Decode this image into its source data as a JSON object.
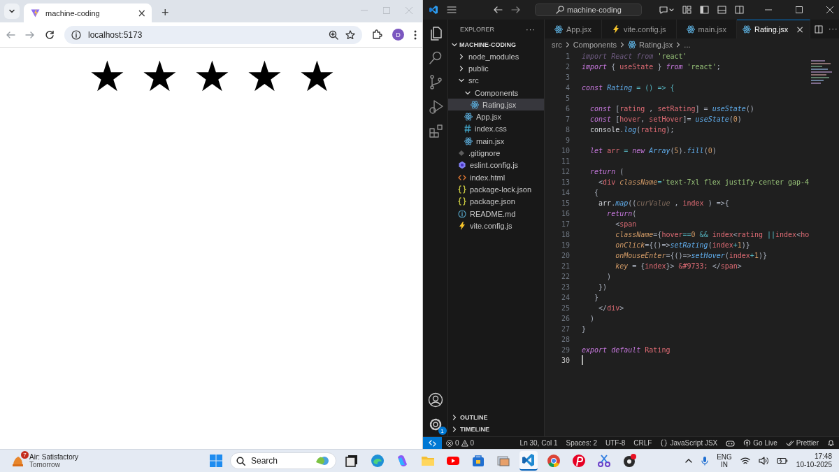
{
  "browser": {
    "tab": {
      "title": "machine-coding",
      "close": "×"
    },
    "new_tab": "+",
    "address": "localhost:5173",
    "profile_initial": "D",
    "page": {
      "rating_stars": [
        "★",
        "★",
        "★",
        "★",
        "★"
      ]
    }
  },
  "editor": {
    "command_center": "machine-coding",
    "activity_bar": [
      {
        "kind": "files",
        "selected": true
      },
      {
        "kind": "search",
        "selected": false
      },
      {
        "kind": "source-control",
        "selected": false
      },
      {
        "kind": "run-debug",
        "selected": false
      },
      {
        "kind": "extensions",
        "selected": false
      }
    ],
    "settings_badge": "1",
    "explorer": {
      "title": "EXPLORER",
      "more": "···",
      "root": "MACHINE-CODING",
      "tree": [
        {
          "label": "node_modules",
          "kind": "folder",
          "expanded": false,
          "selected": false
        },
        {
          "label": "public",
          "kind": "folder",
          "expanded": false,
          "selected": false
        },
        {
          "label": "src",
          "kind": "folder",
          "expanded": true,
          "selected": false,
          "children": [
            {
              "label": "Components",
              "kind": "folder",
              "expanded": true,
              "selected": false,
              "children": [
                {
                  "label": "Rating.jsx",
                  "kind": "react",
                  "selected": true
                }
              ]
            },
            {
              "label": "App.jsx",
              "kind": "react",
              "selected": false
            },
            {
              "label": "index.css",
              "kind": "css",
              "selected": false
            },
            {
              "label": "main.jsx",
              "kind": "react",
              "selected": false
            }
          ]
        },
        {
          "label": ".gitignore",
          "kind": "git",
          "selected": false
        },
        {
          "label": "eslint.config.js",
          "kind": "eslint",
          "selected": false
        },
        {
          "label": "index.html",
          "kind": "html",
          "selected": false
        },
        {
          "label": "package-lock.json",
          "kind": "json",
          "selected": false
        },
        {
          "label": "package.json",
          "kind": "json",
          "selected": false
        },
        {
          "label": "README.md",
          "kind": "info",
          "selected": false
        },
        {
          "label": "vite.config.js",
          "kind": "vite",
          "selected": false
        }
      ],
      "sections": [
        "OUTLINE",
        "TIMELINE"
      ]
    },
    "tabs": [
      {
        "label": "App.jsx",
        "kind": "react",
        "selected": false
      },
      {
        "label": "vite.config.js",
        "kind": "vite",
        "selected": false
      },
      {
        "label": "main.jsx",
        "kind": "react",
        "selected": false
      },
      {
        "label": "Rating.jsx",
        "kind": "react",
        "selected": true
      }
    ],
    "tab_close": "×",
    "tab_more": "···",
    "breadcrumb": [
      {
        "label": "src",
        "kind": "folder"
      },
      {
        "label": "Components",
        "kind": "folder"
      },
      {
        "label": "Rating.jsx",
        "kind": "react"
      },
      {
        "label": "...",
        "kind": "symbol"
      }
    ],
    "code": {
      "lines": [
        {
          "number": "1",
          "active": false,
          "tokens": [
            {
              "text": "import React from ",
              "kind": "unused"
            },
            {
              "text": "'react'",
              "kind": "string"
            }
          ]
        },
        {
          "number": "2",
          "active": false,
          "tokens": [
            {
              "text": "import",
              "kind": "keyword"
            },
            {
              "text": " { ",
              "kind": "punct"
            },
            {
              "text": "useState",
              "kind": "ident"
            },
            {
              "text": " } ",
              "kind": "punct"
            },
            {
              "text": "from",
              "kind": "keyword"
            },
            {
              "text": " 'react'",
              "kind": "string"
            },
            {
              "text": ";",
              "kind": "punct"
            }
          ]
        },
        {
          "number": "3",
          "active": false
        },
        {
          "number": "4",
          "active": false,
          "tokens": [
            {
              "text": "const",
              "kind": "keyword"
            },
            {
              "text": " Rating",
              "kind": "function"
            },
            {
              "text": " = () => {",
              "kind": "operator"
            }
          ]
        },
        {
          "number": "5",
          "active": false
        },
        {
          "number": "6",
          "active": false,
          "tokens": [
            {
              "text": "  const",
              "kind": "keyword"
            },
            {
              "text": " [",
              "kind": "punct"
            },
            {
              "text": "rating",
              "kind": "ident"
            },
            {
              "text": " , ",
              "kind": "punct"
            },
            {
              "text": "setRating",
              "kind": "ident"
            },
            {
              "text": "] = ",
              "kind": "punct"
            },
            {
              "text": "useState",
              "kind": "function"
            },
            {
              "text": "()",
              "kind": "punct"
            }
          ]
        },
        {
          "number": "7",
          "active": false,
          "tokens": [
            {
              "text": "  const",
              "kind": "keyword"
            },
            {
              "text": " [",
              "kind": "punct"
            },
            {
              "text": "hover",
              "kind": "ident"
            },
            {
              "text": ", ",
              "kind": "punct"
            },
            {
              "text": "setHover",
              "kind": "ident"
            },
            {
              "text": "]= ",
              "kind": "punct"
            },
            {
              "text": "useState",
              "kind": "function"
            },
            {
              "text": "(",
              "kind": "punct"
            },
            {
              "text": "0",
              "kind": "number"
            },
            {
              "text": ")",
              "kind": "punct"
            }
          ]
        },
        {
          "number": "8",
          "active": false,
          "tokens": [
            {
              "text": "  console",
              "kind": "plain"
            },
            {
              "text": ".",
              "kind": "punct"
            },
            {
              "text": "log",
              "kind": "function"
            },
            {
              "text": "(",
              "kind": "punct"
            },
            {
              "text": "rating",
              "kind": "ident"
            },
            {
              "text": ");",
              "kind": "punct"
            }
          ]
        },
        {
          "number": "9",
          "active": false
        },
        {
          "number": "10",
          "active": false,
          "tokens": [
            {
              "text": "  let",
              "kind": "keyword"
            },
            {
              "text": " arr",
              "kind": "ident"
            },
            {
              "text": " = ",
              "kind": "operator"
            },
            {
              "text": "new",
              "kind": "keyword"
            },
            {
              "text": " Array",
              "kind": "function"
            },
            {
              "text": "(",
              "kind": "punct"
            },
            {
              "text": "5",
              "kind": "number"
            },
            {
              "text": ").",
              "kind": "punct"
            },
            {
              "text": "fill",
              "kind": "function"
            },
            {
              "text": "(",
              "kind": "punct"
            },
            {
              "text": "0",
              "kind": "number"
            },
            {
              "text": ")",
              "kind": "punct"
            }
          ]
        },
        {
          "number": "11",
          "active": false
        },
        {
          "number": "12",
          "active": false,
          "tokens": [
            {
              "text": "  return",
              "kind": "keyword"
            },
            {
              "text": " (",
              "kind": "punct"
            }
          ]
        },
        {
          "number": "13",
          "active": false,
          "tokens": [
            {
              "text": "    <",
              "kind": "punct"
            },
            {
              "text": "div",
              "kind": "tag"
            },
            {
              "text": " className",
              "kind": "attribute"
            },
            {
              "text": "=",
              "kind": "operator"
            },
            {
              "text": "'text-7xl flex justify-center gap-4",
              "kind": "string"
            }
          ]
        },
        {
          "number": "14",
          "active": false,
          "tokens": [
            {
              "text": "   {",
              "kind": "punct"
            }
          ]
        },
        {
          "number": "15",
          "active": false,
          "tokens": [
            {
              "text": "    arr",
              "kind": "plain"
            },
            {
              "text": ".",
              "kind": "punct"
            },
            {
              "text": "map",
              "kind": "function"
            },
            {
              "text": "((",
              "kind": "punct"
            },
            {
              "text": "curValue",
              "kind": "param"
            },
            {
              "text": " , ",
              "kind": "punct"
            },
            {
              "text": "index",
              "kind": "ident"
            },
            {
              "text": " ) =>{",
              "kind": "punct"
            }
          ]
        },
        {
          "number": "16",
          "active": false,
          "tokens": [
            {
              "text": "      return",
              "kind": "keyword"
            },
            {
              "text": "(",
              "kind": "punct"
            }
          ]
        },
        {
          "number": "17",
          "active": false,
          "tokens": [
            {
              "text": "        <",
              "kind": "punct"
            },
            {
              "text": "span",
              "kind": "tag"
            }
          ]
        },
        {
          "number": "18",
          "active": false,
          "tokens": [
            {
              "text": "        className",
              "kind": "attribute"
            },
            {
              "text": "={",
              "kind": "punct"
            },
            {
              "text": "hover",
              "kind": "ident"
            },
            {
              "text": "==",
              "kind": "operator"
            },
            {
              "text": "0",
              "kind": "number"
            },
            {
              "text": " && ",
              "kind": "operator"
            },
            {
              "text": "index",
              "kind": "ident"
            },
            {
              "text": "<",
              "kind": "punct"
            },
            {
              "text": "rating",
              "kind": "ident"
            },
            {
              "text": " ||",
              "kind": "operator"
            },
            {
              "text": "index",
              "kind": "ident"
            },
            {
              "text": "<",
              "kind": "punct"
            },
            {
              "text": "ho",
              "kind": "ident"
            }
          ]
        },
        {
          "number": "19",
          "active": false,
          "tokens": [
            {
              "text": "        onClick",
              "kind": "attribute"
            },
            {
              "text": "={()=>",
              "kind": "punct"
            },
            {
              "text": "setRating",
              "kind": "function"
            },
            {
              "text": "(",
              "kind": "punct"
            },
            {
              "text": "index",
              "kind": "ident"
            },
            {
              "text": "+",
              "kind": "operator"
            },
            {
              "text": "1",
              "kind": "number"
            },
            {
              "text": ")}",
              "kind": "punct"
            }
          ]
        },
        {
          "number": "20",
          "active": false,
          "tokens": [
            {
              "text": "        onMouseEnter",
              "kind": "attribute"
            },
            {
              "text": "={()=>",
              "kind": "punct"
            },
            {
              "text": "setHover",
              "kind": "function"
            },
            {
              "text": "(",
              "kind": "punct"
            },
            {
              "text": "index",
              "kind": "ident"
            },
            {
              "text": "+",
              "kind": "operator"
            },
            {
              "text": "1",
              "kind": "number"
            },
            {
              "text": ")}",
              "kind": "punct"
            }
          ]
        },
        {
          "number": "21",
          "active": false,
          "tokens": [
            {
              "text": "        key",
              "kind": "attribute"
            },
            {
              "text": " = {",
              "kind": "punct"
            },
            {
              "text": "index",
              "kind": "ident"
            },
            {
              "text": "}> ",
              "kind": "punct"
            },
            {
              "text": "&#9733;",
              "kind": "ident"
            },
            {
              "text": " </",
              "kind": "punct"
            },
            {
              "text": "span",
              "kind": "tag"
            },
            {
              "text": ">",
              "kind": "punct"
            }
          ]
        },
        {
          "number": "22",
          "active": false,
          "tokens": [
            {
              "text": "      )",
              "kind": "punct"
            }
          ]
        },
        {
          "number": "23",
          "active": false,
          "tokens": [
            {
              "text": "    })",
              "kind": "punct"
            }
          ]
        },
        {
          "number": "24",
          "active": false,
          "tokens": [
            {
              "text": "   }",
              "kind": "punct"
            }
          ]
        },
        {
          "number": "25",
          "active": false,
          "tokens": [
            {
              "text": "    </",
              "kind": "punct"
            },
            {
              "text": "div",
              "kind": "tag"
            },
            {
              "text": ">",
              "kind": "punct"
            }
          ]
        },
        {
          "number": "26",
          "active": false,
          "tokens": [
            {
              "text": "  )",
              "kind": "punct"
            }
          ]
        },
        {
          "number": "27",
          "active": false,
          "tokens": [
            {
              "text": "}",
              "kind": "punct"
            }
          ]
        },
        {
          "number": "28",
          "active": false
        },
        {
          "number": "29",
          "active": false,
          "tokens": [
            {
              "text": "export",
              "kind": "keyword"
            },
            {
              "text": " default",
              "kind": "keyword"
            },
            {
              "text": " Rating",
              "kind": "ident"
            }
          ]
        },
        {
          "number": "30",
          "active": true
        }
      ]
    },
    "status_bar": {
      "errors": "0",
      "warnings": "0",
      "items": [
        {
          "text": "Ln 30, Col 1",
          "kind": "text"
        },
        {
          "text": "Spaces: 2",
          "kind": "text"
        },
        {
          "text": "UTF-8",
          "kind": "text"
        },
        {
          "text": "CRLF",
          "kind": "text"
        },
        {
          "text": "JavaScript JSX",
          "kind": "language"
        },
        {
          "kind": "copilot"
        },
        {
          "text": "Go Live",
          "kind": "live"
        },
        {
          "text": "Prettier",
          "kind": "prettier"
        },
        {
          "kind": "bell"
        }
      ]
    }
  },
  "taskbar": {
    "weather": {
      "badge": "7",
      "title": "Air: Satisfactory",
      "subtitle": "Tomorrow"
    },
    "search": "Search",
    "apps": [
      {
        "kind": "task-view",
        "active": false
      },
      {
        "kind": "edge",
        "active": false
      },
      {
        "kind": "copilot",
        "active": false
      },
      {
        "kind": "file-explorer",
        "active": false
      },
      {
        "kind": "youtube",
        "active": false
      },
      {
        "kind": "store",
        "active": false
      },
      {
        "kind": "photos",
        "active": false
      },
      {
        "kind": "vscode",
        "active": true
      },
      {
        "kind": "chrome",
        "active": false
      },
      {
        "kind": "pinterest",
        "active": false
      },
      {
        "kind": "snipping-tool",
        "active": false
      },
      {
        "kind": "recorder",
        "active": false
      }
    ],
    "language": "ENG",
    "region": "IN",
    "time": "17:48",
    "date": "10-10-2025"
  }
}
